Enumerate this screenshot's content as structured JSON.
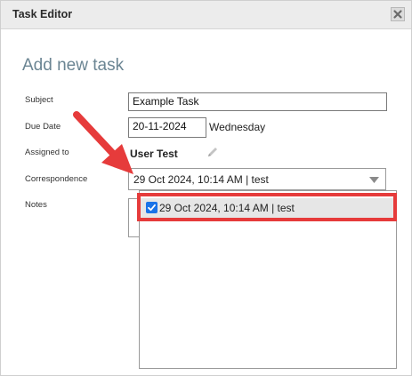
{
  "window": {
    "title": "Task Editor",
    "close_icon": "close-icon"
  },
  "form": {
    "heading": "Add new task",
    "subject": {
      "label": "Subject",
      "value": "Example Task"
    },
    "due_date": {
      "label": "Due Date",
      "value": "20-11-2024",
      "weekday": "Wednesday"
    },
    "assigned_to": {
      "label": "Assigned to",
      "value": "User Test",
      "edit_icon": "pencil-icon"
    },
    "correspondence": {
      "label": "Correspondence",
      "selected": "29 Oct 2024, 10:14 AM | test",
      "options": [
        {
          "label": "29 Oct 2024, 10:14 AM | test",
          "checked": true
        }
      ]
    },
    "notes": {
      "label": "Notes",
      "value": ""
    }
  },
  "annotations": {
    "arrow_color": "#e63b3b",
    "highlight_color": "#e63b3b"
  },
  "colors": {
    "titlebar": "#ececec",
    "heading": "#6b8593",
    "checkbox": "#1a73e8"
  }
}
